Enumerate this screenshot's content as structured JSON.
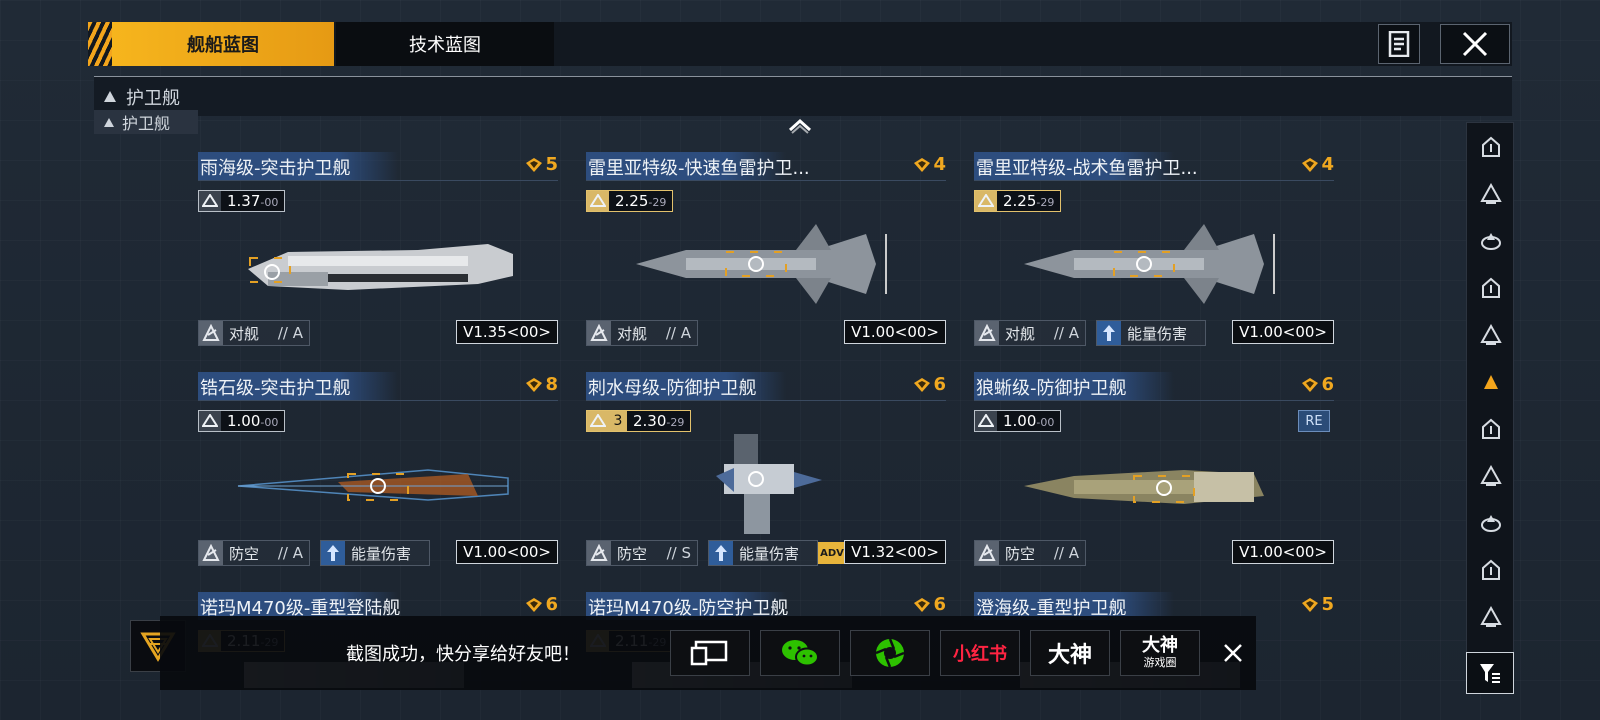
{
  "tabs": [
    {
      "label": "舰船蓝图",
      "active": true
    },
    {
      "label": "技术蓝图",
      "active": false
    }
  ],
  "section": {
    "label": "护卫舰",
    "sticky_label": "护卫舰"
  },
  "cards": [
    {
      "title": "雨海级-突击护卫舰",
      "cost": "5",
      "pill": {
        "value": "1.37",
        "sub": "00",
        "gold": false
      },
      "tags": [
        {
          "label": "对舰",
          "grade": "// A"
        }
      ],
      "version": "V1.35<00>",
      "adv": false,
      "re": false,
      "hull": "white"
    },
    {
      "title": "雷里亚特级-快速鱼雷护卫...",
      "cost": "4",
      "pill": {
        "value": "2.25",
        "sub": "29",
        "gold": true
      },
      "tags": [
        {
          "label": "对舰",
          "grade": "// A"
        }
      ],
      "version": "V1.00<00>",
      "adv": false,
      "re": false,
      "hull": "grey"
    },
    {
      "title": "雷里亚特级-战术鱼雷护卫...",
      "cost": "4",
      "pill": {
        "value": "2.25",
        "sub": "29",
        "gold": true
      },
      "tags": [
        {
          "label": "对舰",
          "grade": "// A"
        },
        {
          "label": "能量伤害",
          "grade": ""
        }
      ],
      "version": "V1.00<00>",
      "adv": false,
      "re": false,
      "hull": "grey"
    },
    {
      "title": "锆石级-突击护卫舰",
      "cost": "8",
      "pill": {
        "value": "1.00",
        "sub": "00",
        "gold": false
      },
      "tags": [
        {
          "label": "防空",
          "grade": "// A"
        },
        {
          "label": "能量伤害",
          "grade": ""
        }
      ],
      "version": "V1.00<00>",
      "adv": false,
      "re": false,
      "hull": "blueprint"
    },
    {
      "title": "刺水母级-防御护卫舰",
      "cost": "6",
      "pill": {
        "rank": "3",
        "value": "2.30",
        "sub": "29",
        "gold": true
      },
      "tags": [
        {
          "label": "防空",
          "grade": "// S"
        },
        {
          "label": "能量伤害",
          "grade": ""
        }
      ],
      "version": "V1.32<00>",
      "adv": true,
      "adv_label": "ADV",
      "re": false,
      "hull": "jelly"
    },
    {
      "title": "狼蜥级-防御护卫舰",
      "cost": "6",
      "pill": {
        "value": "1.00",
        "sub": "00",
        "gold": false
      },
      "tags": [
        {
          "label": "防空",
          "grade": "// A"
        }
      ],
      "version": "V1.00<00>",
      "adv": false,
      "re": true,
      "re_label": "RE",
      "hull": "olive"
    }
  ],
  "partial_cards": [
    {
      "title": "诺玛M470级-重型登陆舰",
      "cost": "6",
      "pill": {
        "value": "2.11",
        "sub": "29"
      }
    },
    {
      "title": "诺玛M470级-防空护卫舰",
      "cost": "6",
      "pill": {
        "value": "2.11",
        "sub": "29"
      }
    },
    {
      "title": "澄海级-重型护卫舰",
      "cost": "5",
      "pill": {
        "value": "",
        "sub": ""
      }
    }
  ],
  "share": {
    "message": "截图成功，快分享给好友吧！",
    "buttons": [
      {
        "name": "screenshot-share-button",
        "label": ""
      },
      {
        "name": "wechat-share-button",
        "label": ""
      },
      {
        "name": "moments-share-button",
        "label": ""
      },
      {
        "name": "xiaohongshu-share-button",
        "label": "小红书"
      },
      {
        "name": "dashen-share-button",
        "label": "大神"
      },
      {
        "name": "dashen-game-share-button",
        "label": "大神",
        "sub": "游戏圈"
      }
    ]
  },
  "colors": {
    "accent": "#f3a51c",
    "title_bg": "#2d4d7e",
    "sidebar_active": "#f3a51c"
  }
}
